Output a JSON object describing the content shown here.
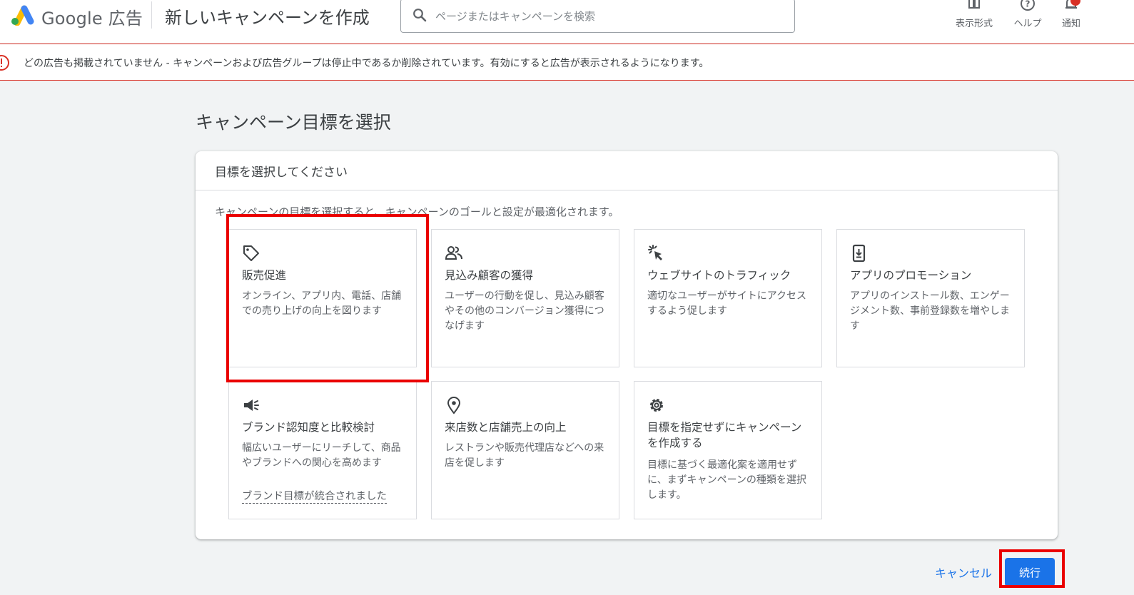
{
  "header": {
    "brand": "Google 広告",
    "page_title": "新しいキャンペーンを作成",
    "search_placeholder": "ページまたはキャンペーンを検索",
    "view_label": "表示形式",
    "help_label": "ヘルプ",
    "notifications_label": "通知",
    "notification_badge_color": "#d93025",
    "logo_colors": [
      "#fbbc04",
      "#4285f4",
      "#34a853"
    ]
  },
  "alert": {
    "message": "どの広告も掲載されていません - キャンペーンおよび広告グループは停止中であるか削除されています。有効にすると広告が表示されるようになります。",
    "color": "#d93025"
  },
  "main": {
    "section_title": "キャンペーン目標を選択",
    "panel_title": "目標を選択してください",
    "panel_description": "キャンペーンの目標を選択すると、キャンペーンのゴールと設定が最適化されます。",
    "goals": [
      {
        "icon": "tag-icon",
        "title": "販売促進",
        "description": "オンライン、アプリ内、電話、店舗での売り上げの向上を図ります",
        "highlighted": true
      },
      {
        "icon": "people-icon",
        "title": "見込み顧客の獲得",
        "description": "ユーザーの行動を促し、見込み顧客やその他のコンバージョン獲得につなげます"
      },
      {
        "icon": "click-icon",
        "title": "ウェブサイトのトラフィック",
        "description": "適切なユーザーがサイトにアクセスするよう促します"
      },
      {
        "icon": "phone-download-icon",
        "title": "アプリのプロモーション",
        "description": "アプリのインストール数、エンゲージメント数、事前登録数を増やします"
      },
      {
        "icon": "megaphone-icon",
        "title": "ブランド認知度と比較検討",
        "description": "幅広いユーザーにリーチして、商品やブランドへの関心を高めます",
        "link": "ブランド目標が統合されました"
      },
      {
        "icon": "location-pin-icon",
        "title": "来店数と店舗売上の向上",
        "description": "レストランや販売代理店などへの来店を促します"
      },
      {
        "icon": "gear-icon",
        "title": "目標を指定せずにキャンペーンを作成する",
        "description": "目標に基づく最適化案を適用せずに、まずキャンペーンの種類を選択します。"
      }
    ]
  },
  "footer": {
    "cancel_label": "キャンセル",
    "continue_label": "続行",
    "highlight_color": "#ea0000",
    "accent": "#1a73e8"
  }
}
